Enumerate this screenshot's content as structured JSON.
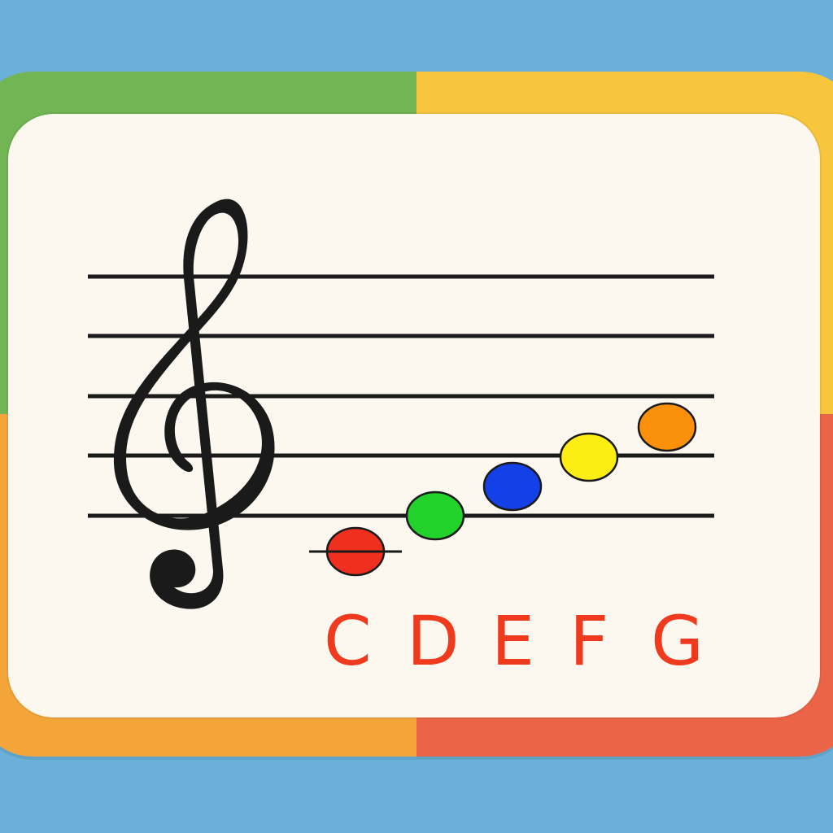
{
  "notes": [
    {
      "name": "C",
      "color": "#f0301e"
    },
    {
      "name": "D",
      "color": "#22d22a"
    },
    {
      "name": "E",
      "color": "#1440e8"
    },
    {
      "name": "F",
      "color": "#fcee12"
    },
    {
      "name": "G",
      "color": "#fb900a"
    }
  ],
  "staff_lines": 5,
  "clef": "treble-clef-icon",
  "letter_color": "#f03a1e"
}
